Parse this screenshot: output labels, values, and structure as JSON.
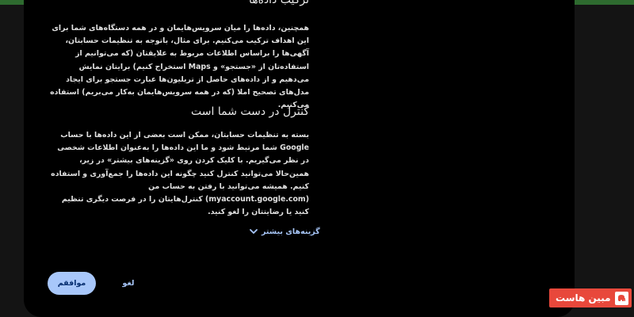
{
  "section1": {
    "heading": "ترکیب داده‌ها",
    "body": "همچنین، داده‌ها را میان سرویس‌هایمان و در همه دستگاه‌های شما برای این اهداف ترکیب می‌کنیم. برای مثال، باتوجه به تنظیمات حسابتان، آگهی‌ها را براساس اطلاعات مربوط به علایقتان (که می‌توانیم از استفاده‌تان از «جستجو» و Maps استخراج کنیم) برایتان نمایش می‌دهیم و از داده‌های حاصل از تریلیون‌ها عبارت جستجو برای ایجاد مدل‌های تصحیح املا (که در همه سرویس‌هایمان به‌کار می‌بریم) استفاده می‌کنیم."
  },
  "section2": {
    "heading": "کنترل در دست شما است",
    "body": "بسته به تنظیمات حسابتان، ممکن است بعضی از این داده‌ها با حساب Google شما مرتبط شود و ما این داده‌ها را به‌عنوان اطلاعات شخصی در نظر می‌گیریم. با کلیک کردن روی «گزینه‌های بیشتر» در زیر، همین‌حالا می‌توانید کنترل کنید چگونه این داده‌ها را جمع‌آوری و استفاده کنیم. همیشه می‌توانید با رفتن به حساب من (myaccount.google.com) کنترل‌هایتان را در فرصت دیگری تنظیم کنید یا رضایتتان را لغو کنید."
  },
  "more_options": {
    "label": "گزینه‌های بیشتر",
    "icon": "chevron-down-icon"
  },
  "buttons": {
    "accept_label": "موافقم",
    "cancel_label": "لغو"
  },
  "watermark": {
    "text": "مبین هاست"
  },
  "colors": {
    "accent": "#a8c7fa",
    "background": "#000000",
    "badge": "#e8483b"
  }
}
